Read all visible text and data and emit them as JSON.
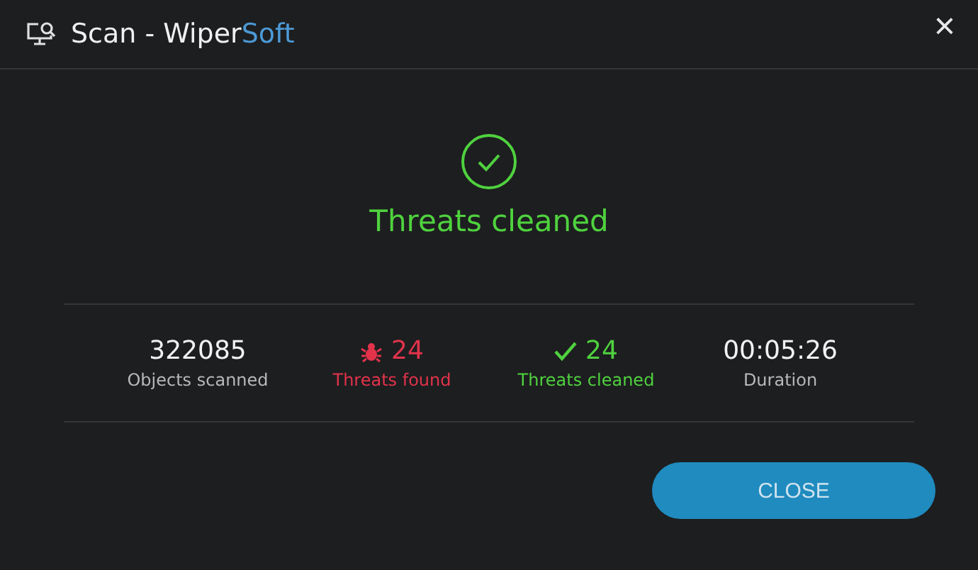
{
  "window": {
    "title": "Scan - Wiper",
    "brand": "Soft",
    "close": "×"
  },
  "result": {
    "success": true,
    "message": "Threats cleaned"
  },
  "stats": [
    {
      "kind": "plain",
      "value": "322085",
      "label": "Objects scanned"
    },
    {
      "kind": "found",
      "value": "24",
      "label": "Threats found"
    },
    {
      "kind": "cleaned",
      "value": "24",
      "label": "Threats cleaned"
    },
    {
      "kind": "plain",
      "value": "00:05:26",
      "label": "Duration"
    }
  ],
  "buttons": [
    {
      "label": "CLOSE"
    }
  ]
}
